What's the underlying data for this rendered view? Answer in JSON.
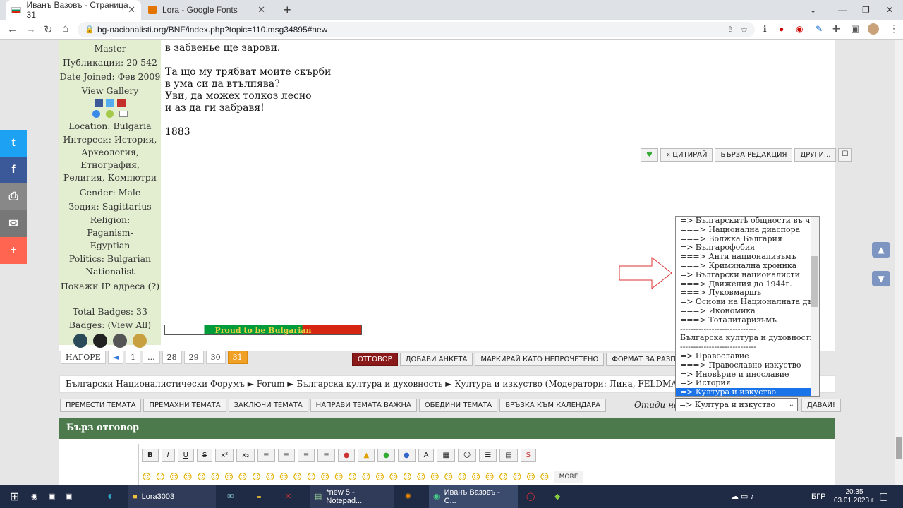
{
  "browser": {
    "tabs": [
      {
        "title": "Иванъ Вазовъ - Страница 31",
        "active": true
      },
      {
        "title": "Lora - Google Fonts",
        "active": false
      }
    ],
    "url": "bg-nacionalisti.org/BNF/index.php?topic=110.msg34895#new"
  },
  "sidebar": {
    "rank": "Master",
    "posts": "Публикации: 20 542",
    "joined": "Date Joined: Фев 2009",
    "gallery": "View Gallery",
    "location": "Location: Bulgaria",
    "interests_label": "Интереси:",
    "interests": "История, Археология, Етнография, Религия, Компютри",
    "gender": "Gender: Male",
    "zodiac": "Зодия: Sagittarius",
    "religion": "Religion: Paganism-Egyptian",
    "politics": "Politics: Bulgarian Nationalist",
    "ip": "Покажи IP адреса (?)",
    "badges_total": "Total Badges: 33",
    "badges": "Badges: (View All)"
  },
  "post": {
    "lines": [
      "в забвенье ще зарови.",
      "",
      "Та що му трябват моите скърби",
      "в ума си да втълпява?",
      "Уви, да можех толкоз лесно",
      "и аз да ги забравя!",
      "",
      "1883"
    ],
    "banner": "Proud to be Bulgarian"
  },
  "post_actions": [
    "ЦИТИРАЙ",
    "БЪРЗА РЕДАКЦИЯ",
    "ДРУГИ..."
  ],
  "pagination": {
    "up": "НАГОРЕ",
    "pages": [
      "1",
      "...",
      "28",
      "29",
      "30",
      "31"
    ],
    "current": "31"
  },
  "thread_buttons": [
    "ОТГОВОР",
    "ДОБАВИ АНКЕТА",
    "МАРКИРАЙ КАТО НЕПРОЧЕТЕНО",
    "ФОРМАТ ЗА РАЗПЕЧАТВАНЕ"
  ],
  "breadcrumb": "Български Националистически Форумъ ► Forum ► Българска култура и духовность ► Култура и изкуство (Модератори: Лина, FELDMARSCHALL) ► Иванъ Вазовъ",
  "mod_buttons": [
    "ПРЕМЕСТИ ТЕМАТА",
    "ПРЕМАХНИ ТЕМАТА",
    "ЗАКЛЮЧИ ТЕМАТА",
    "НАПРАВИ ТЕМАТА ВАЖНА",
    "ОБЕДИНИ ТЕМАТА",
    "ВРЪЗКА КЪМ КАЛЕНДАРА"
  ],
  "goto": {
    "label": "Отиди на:",
    "value": "=> Култура и изкуство",
    "button": "ДАВАЙ!"
  },
  "dropdown_items": [
    "=> Българскитѣ общности въ чужбина",
    "===> Национална диаспора",
    "===> Волжка България",
    "=> Българофобия",
    "===> Анти национализъмъ",
    "===> Криминална хроника",
    "=> Български националисти",
    "===> Движения до 1944г.",
    "===> Луковмаршъ",
    "=> Основи на Националната държава",
    "===> Икономика",
    "===> Тоталитаризъмъ",
    "-----------------------------",
    "Българска култура и духовность",
    "-----------------------------",
    "=> Православие",
    "===> Православно изкуство",
    "=> Иновѣрие и инославие",
    "=> История",
    "=> Култура и изкуство"
  ],
  "quick_reply": "Бърз отговор",
  "more": "MORE",
  "taskbar": {
    "items": [
      "Lora3003",
      "*new 5 - Notepad...",
      "Иванъ Вазовъ - С..."
    ],
    "lang": "БГР",
    "time": "20:35",
    "date": "03.01.2023 г."
  }
}
